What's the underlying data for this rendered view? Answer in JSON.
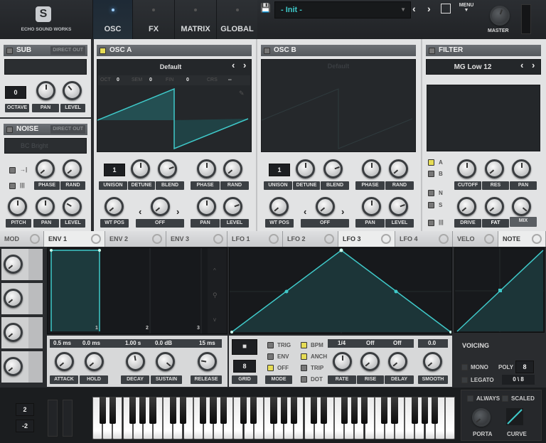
{
  "brand": {
    "name": "ECHO SOUND WORKS"
  },
  "tabs": [
    {
      "label": "OSC"
    },
    {
      "label": "FX"
    },
    {
      "label": "MATRIX"
    },
    {
      "label": "GLOBAL"
    }
  ],
  "preset": {
    "name": "- Init -",
    "menu": "MENU",
    "master": "MASTER"
  },
  "sub": {
    "title": "SUB",
    "direct_out": "DIRECT OUT",
    "octave": "0",
    "labels": [
      "OCTAVE",
      "PAN",
      "LEVEL"
    ]
  },
  "noise": {
    "title": "NOISE",
    "direct_out": "DIRECT OUT",
    "preset": "BC Bright",
    "labels1": [
      "PHASE",
      "RAND"
    ],
    "labels2": [
      "PITCH",
      "PAN",
      "LEVEL"
    ]
  },
  "osc_a": {
    "title": "OSC A",
    "wavetable": "Default",
    "oct_label": "OCT",
    "oct": "0",
    "sem_label": "SEM",
    "sem": "0",
    "fin_label": "FIN",
    "fin": "0",
    "crs_label": "CRS",
    "crs": "--",
    "unison": "1",
    "labels1": [
      "UNISON",
      "DETUNE",
      "BLEND",
      "PHASE",
      "RAND"
    ],
    "labels2": [
      "WT POS",
      "OFF",
      "PAN",
      "LEVEL"
    ]
  },
  "osc_b": {
    "title": "OSC B",
    "wavetable": "Default",
    "unison": "1",
    "labels1": [
      "UNISON",
      "DETUNE",
      "BLEND",
      "PHASE",
      "RAND"
    ],
    "labels2": [
      "WT POS",
      "OFF",
      "PAN",
      "LEVEL"
    ]
  },
  "filter": {
    "title": "FILTER",
    "type": "MG Low 12",
    "routes": [
      "A",
      "B",
      "N",
      "S"
    ],
    "labels1": [
      "CUTOFF",
      "RES",
      "PAN"
    ],
    "labels2": [
      "DRIVE",
      "FAT",
      "MIX"
    ]
  },
  "mod_tabs": [
    {
      "label": "MOD"
    },
    {
      "label": "ENV 1"
    },
    {
      "label": "ENV 2"
    },
    {
      "label": "ENV 3"
    },
    {
      "label": "LFO 1"
    },
    {
      "label": "LFO 2"
    },
    {
      "label": "LFO 3"
    },
    {
      "label": "LFO 4"
    },
    {
      "label": "VELO"
    },
    {
      "label": "NOTE"
    }
  ],
  "env": {
    "values": [
      "0.5 ms",
      "0.0 ms",
      "1.00 s",
      "0.0 dB",
      "15 ms"
    ],
    "labels": [
      "ATTACK",
      "HOLD",
      "DECAY",
      "SUSTAIN",
      "RELEASE"
    ],
    "markers": [
      "1",
      "2",
      "3"
    ]
  },
  "lfo": {
    "grid": "8",
    "grid_label": "GRID",
    "mode_label": "MODE",
    "modes": [
      {
        "label": "TRIG",
        "on": false
      },
      {
        "label": "ENV",
        "on": false
      },
      {
        "label": "OFF",
        "on": true
      }
    ],
    "opts": [
      {
        "label": "BPM",
        "on": true
      },
      {
        "label": "ANCH",
        "on": true
      },
      {
        "label": "TRIP",
        "on": false
      },
      {
        "label": "DOT",
        "on": false
      }
    ],
    "values": [
      "1/4",
      "Off",
      "Off",
      "0.0"
    ],
    "labels": [
      "RATE",
      "RISE",
      "DELAY",
      "SMOOTH"
    ]
  },
  "voicing": {
    "title": "VOICING",
    "mono": "MONO",
    "legato": "LEGATO",
    "poly_label": "POLY",
    "poly": "8",
    "voices": "0 \\ 8"
  },
  "keyboard": {
    "pitch_up": "2",
    "pitch_down": "-2",
    "always": "ALWAYS",
    "scaled": "SCALED",
    "porta": "PORTA",
    "curve": "CURVE"
  },
  "colors": {
    "accent": "#3fc9c9",
    "led": "#e6dc55"
  }
}
